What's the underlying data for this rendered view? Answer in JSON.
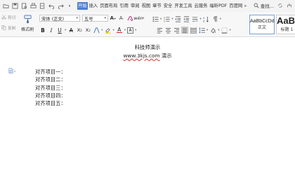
{
  "menu": {
    "tabs": [
      {
        "label": "开始",
        "active": true
      },
      {
        "label": "插入",
        "active": false
      },
      {
        "label": "页面布局",
        "active": false
      },
      {
        "label": "引用",
        "active": false
      },
      {
        "label": "审阅",
        "active": false
      },
      {
        "label": "视图",
        "active": false
      },
      {
        "label": "章节",
        "active": false
      },
      {
        "label": "安全",
        "active": false
      },
      {
        "label": "开发工具",
        "active": false
      },
      {
        "label": "云服务",
        "active": false
      },
      {
        "label": "福昕PDF",
        "active": false
      },
      {
        "label": "百度网",
        "active": false
      }
    ],
    "search_label": "查找...",
    "accent_color": "#4a7fd0"
  },
  "ribbon": {
    "cut_label": "剪切",
    "copy_label": "复制",
    "format_painter_label": "格式刷",
    "font_name": "宋体 (正文)",
    "font_size": "五号",
    "styles": [
      {
        "sample": "AaBbCcDd",
        "name": "正文"
      },
      {
        "sample": "AaBb",
        "name": "标题 1"
      }
    ]
  },
  "document": {
    "title_line1": "科技师演示",
    "title_link": "www.3kjs.com",
    "title_suffix": " 演示",
    "items": [
      "对齐项目一：",
      "对齐项目二：",
      "对齐项目三：",
      "对齐项目四：",
      "对齐项目五："
    ]
  }
}
